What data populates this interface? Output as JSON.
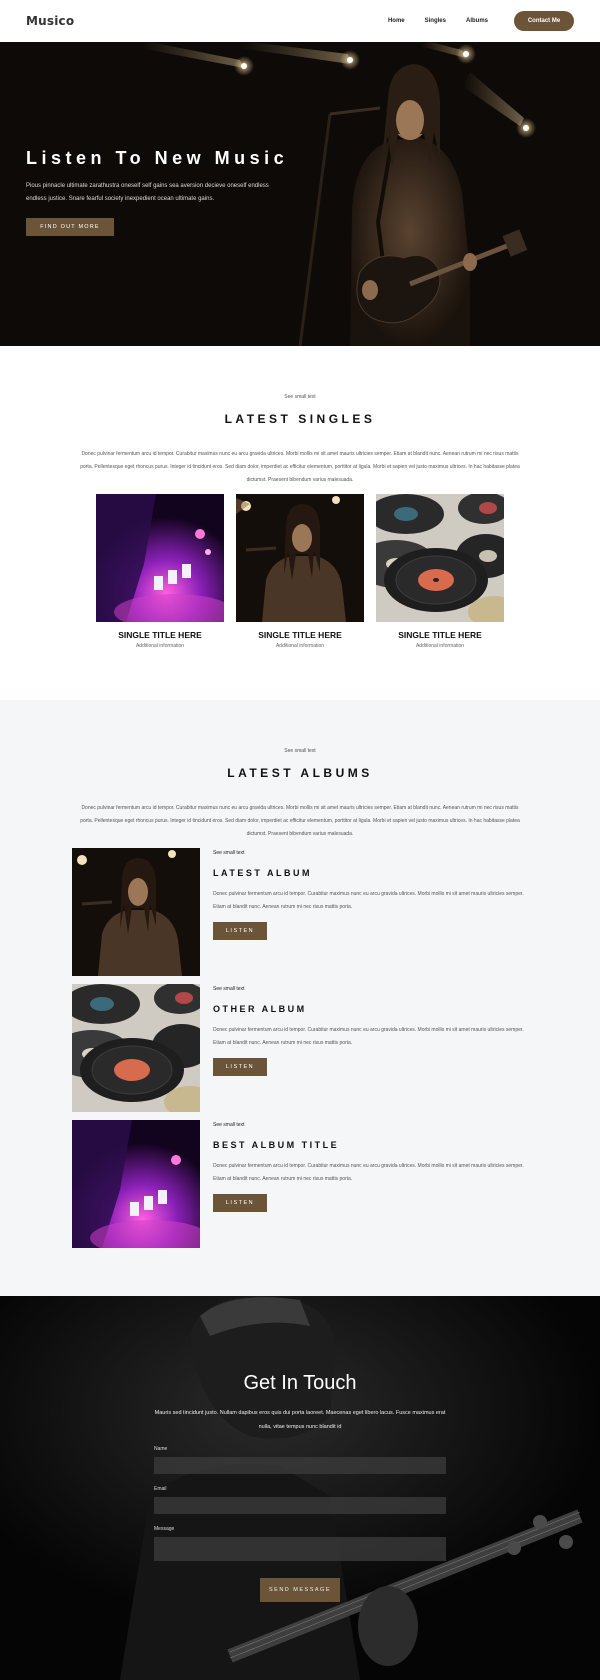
{
  "header": {
    "logo": "Musico",
    "nav": [
      "Home",
      "Singles",
      "Albums"
    ],
    "cta": "Contact Me"
  },
  "hero": {
    "title": "Listen To New Music",
    "text": "Pious pinnacle ultimate zarathustra oneself self gains sea aversion decieve oneself endless endless justice. Snare fearful society inexpedient ocean ultimate gains.",
    "button": "FIND OUT MORE"
  },
  "singles": {
    "small": "See small text",
    "title": "LATEST SINGLES",
    "desc": "Donec pulvinar fermentum arcu id tempor. Curabitur maximus nunc eu arcu gravida ultrices. Morbi mollis mi sit amet mauris ultricies semper. Etiam at blandit nunc. Aenean rutrum mi nec risus mattis porta. Pellentesque eget rhoncus purus. Integer id tincidunt eros. Sed diam dolor, imperdiet ac efficitur elementum, porttitor at ligula. Morbi et sapien vel justo maximus ultrices. In hac habitasse platea dictumst. Praesent bibendum varius malesuada.",
    "items": [
      {
        "title": "SINGLE TITLE HERE",
        "info": "Additional information"
      },
      {
        "title": "SINGLE TITLE HERE",
        "info": "Additional information"
      },
      {
        "title": "SINGLE TITLE HERE",
        "info": "Additional information"
      }
    ]
  },
  "albums": {
    "small": "See small text",
    "title": "LATEST ALBUMS",
    "desc": "Donec pulvinar fermentum arcu id tempor. Curabitur maximus nunc eu arcu gravida ultrices. Morbi mollis mi sit amet mauris ultricies semper. Etiam at blandit nunc. Aenean rutrum mi nec risus mattis porta. Pellentesque eget rhoncus purus. Integer id tincidunt eros. Sed diam dolor, imperdiet ac efficitur elementum, porttitor at ligula. Morbi et sapien vel justo maximus ultrices. In hac habitasse platea dictumst. Praesent bibendum varius malesuada.",
    "items": [
      {
        "small": "See small text",
        "name": "LATEST ALBUM",
        "text": "Donec pulvinar fermentum arcu id tempor. Curabitur maximus nunc eu arcu gravida ultrices. Morbi mollis mi sit amet mauris ultricies semper. Etiam at blandit nunc. Aenean rutrum mi nec risus mattis porta.",
        "button": "LISTEN"
      },
      {
        "small": "See small text",
        "name": "OTHER ALBUM",
        "text": "Donec pulvinar fermentum arcu id tempor. Curabitur maximus nunc eu arcu gravida ultrices. Morbi mollis mi sit amet mauris ultricies semper. Etiam at blandit nunc. Aenean rutrum mi nec risus mattis porta.",
        "button": "LISTEN"
      },
      {
        "small": "See small text",
        "name": "BEST ALBUM TITLE",
        "text": "Donec pulvinar fermentum arcu id tempor. Curabitur maximus nunc eu arcu gravida ultrices. Morbi mollis mi sit amet mauris ultricies semper. Etiam at blandit nunc. Aenean rutrum mi nec risus mattis porta.",
        "button": "LISTEN"
      }
    ]
  },
  "contact": {
    "title": "Get In Touch",
    "text": "Mauris sed tincidunt justo. Nullam dapibus eros quis dui porta laoreet. Maecenas eget libero lacus. Fusce maximus erat nulla, vitae tempus nunc blandit id",
    "fields": [
      "Name",
      "Email",
      "Message"
    ],
    "button": "SEND MESSAGE"
  },
  "colors": {
    "accent": "#6b5438",
    "dark": "#0d0a08",
    "albums_bg": "#f4f6f7"
  }
}
